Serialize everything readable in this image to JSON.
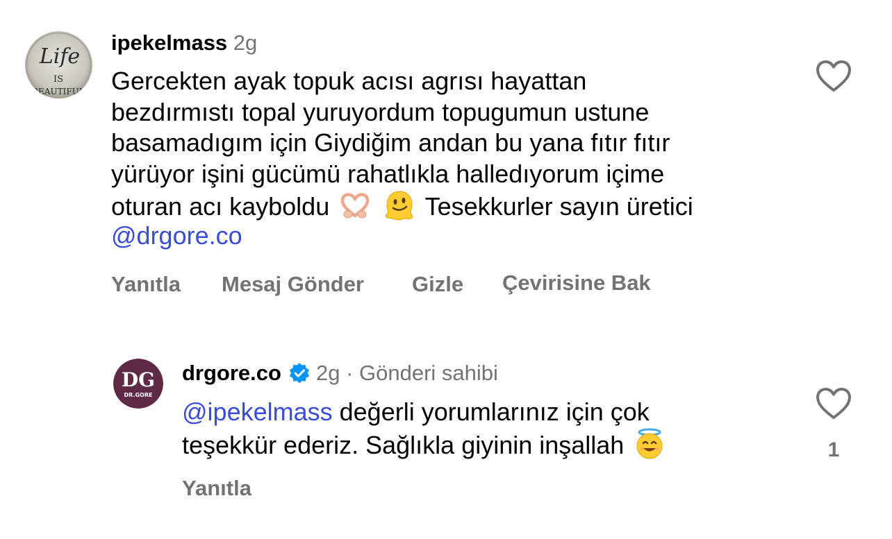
{
  "comments": [
    {
      "username": "ipekelmass",
      "time": "2g",
      "avatar_text": [
        "Life",
        "IS",
        "BEAUTIFUL"
      ],
      "lines": [
        "Gercekten ayak topuk acısı agrısı hayattan",
        "bezdırmıstı topal yuruyordum topugumun ustune",
        "basamadıgım için  Giydiğim andan bu yana fıtır fıtır",
        "yürüyor işini gücümü rahatlıkla halledıyorum içime"
      ],
      "last_line_start": "oturan acı kayboldu",
      "last_line_end": "Tesekkurler sayın üretici",
      "emojis": [
        "heart-hands-emoji",
        "melting-face-emoji"
      ],
      "mention": "@drgore.co",
      "actions": [
        "Yanıtla",
        "Mesaj Gönder",
        "Gizle",
        "Çevirisine Bak"
      ],
      "liked": false
    },
    {
      "username": "drgore.co",
      "verified": true,
      "time": "2g",
      "separator": " · ",
      "role": "Gönderi sahibi",
      "avatar_text": [
        "DG",
        "DR.GORE"
      ],
      "mention": "@ipekelmass",
      "line1_rest": " değerli yorumlarınız için çok",
      "line2": "teşekkür ederiz. Sağlıkla giyinin inşallah",
      "emoji": "smiling-face-with-halo-emoji",
      "actions": [
        "Yanıtla"
      ],
      "like_count": "1",
      "liked": false
    }
  ],
  "colors": {
    "text": "#000000",
    "secondary": "#737373",
    "mention": "#3b4bd6",
    "verified_badge": "#0095f6",
    "brand_avatar": "#5e2a45"
  }
}
